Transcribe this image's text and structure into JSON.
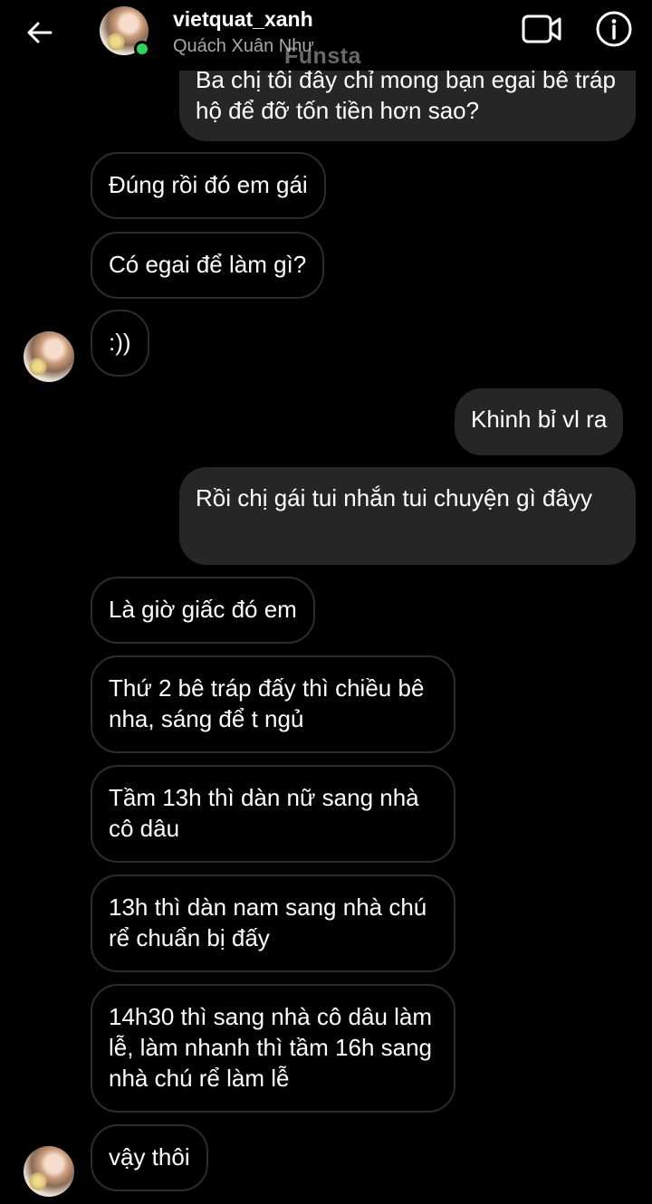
{
  "header": {
    "username": "vietquat_xanh",
    "full_name": "Quách Xuân Như",
    "watermark": "Funsta",
    "online_status_color": "#2dd35c"
  },
  "icons": {
    "back": "arrow-left-icon",
    "video": "video-camera-icon",
    "info": "info-icon"
  },
  "messages": [
    {
      "direction": "sent",
      "text": "Ba chị tôi đây chỉ mong bạn egai bê tráp hộ để đỡ tốn tiền hơn sao?"
    },
    {
      "direction": "received",
      "text": "Đúng rồi đó em gái"
    },
    {
      "direction": "received",
      "text": "Có egai để làm gì?"
    },
    {
      "direction": "received",
      "text": ":))"
    },
    {
      "direction": "sent",
      "text": "Khinh bỉ vl ra"
    },
    {
      "direction": "sent",
      "text": "Rồi chị gái tui nhắn tui chuyện gì đâyy"
    },
    {
      "direction": "received",
      "text": "Là giờ giấc đó em"
    },
    {
      "direction": "received",
      "text": "Thứ 2 bê tráp đấy thì chiều bê nha, sáng để t ngủ"
    },
    {
      "direction": "received",
      "text": "Tầm 13h thì dàn nữ sang nhà cô dâu"
    },
    {
      "direction": "received",
      "text": "13h thì dàn nam sang nhà chú rể chuẩn bị đấy"
    },
    {
      "direction": "received",
      "text": "14h30 thì sang nhà cô dâu làm lễ, làm nhanh thì tầm 16h sang nhà chú rể làm lễ"
    },
    {
      "direction": "received",
      "text": "vậy thôi"
    }
  ]
}
